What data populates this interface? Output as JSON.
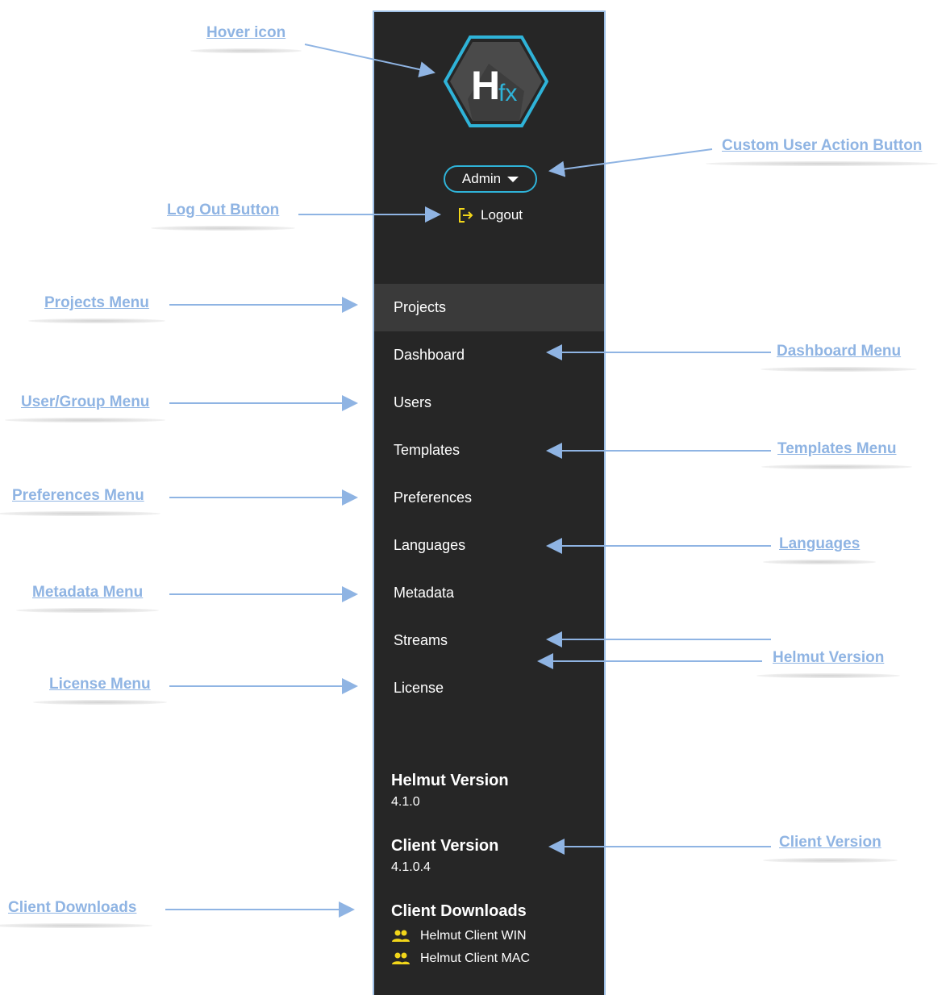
{
  "sidebar": {
    "logo": {
      "letter": "H",
      "suffix": "fx"
    },
    "user_button": {
      "label": "Admin"
    },
    "logout": {
      "label": "Logout"
    },
    "menu": [
      {
        "label": "Projects",
        "active": true
      },
      {
        "label": "Dashboard"
      },
      {
        "label": "Users"
      },
      {
        "label": "Templates"
      },
      {
        "label": "Preferences"
      },
      {
        "label": "Languages"
      },
      {
        "label": "Metadata"
      },
      {
        "label": "Streams"
      },
      {
        "label": "License"
      }
    ],
    "helmut_version": {
      "title": "Helmut Version",
      "value": "4.1.0"
    },
    "client_version": {
      "title": "Client Version",
      "value": "4.1.0.4"
    },
    "client_downloads": {
      "title": "Client Downloads",
      "items": [
        {
          "label": "Helmut Client WIN",
          "icon": "users-icon"
        },
        {
          "label": "Helmut Client MAC",
          "icon": "users-icon"
        }
      ]
    }
  },
  "annotations": {
    "hover_icon": "Hover icon",
    "custom_user_action": "Custom User Action Button",
    "log_out_button": "Log Out Button",
    "projects_menu": "Projects Menu",
    "dashboard_menu": "Dashboard Menu",
    "user_group_menu": "User/Group Menu",
    "templates_menu": "Templates Menu",
    "preferences_menu": "Preferences Menu",
    "languages": "Languages",
    "metadata_menu": "Metadata Menu",
    "helmut_version": "Helmut Version",
    "license_menu": "License Menu",
    "client_version": "Client Version",
    "client_downloads": "Client Downloads"
  },
  "colors": {
    "sidebar_bg": "#262626",
    "active_bg": "#3a3a3a",
    "accent_cyan": "#2fb3d8",
    "accent_yellow": "#f2d61a",
    "annotation_blue": "#8fb4e3"
  }
}
